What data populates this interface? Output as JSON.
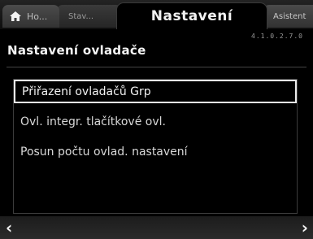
{
  "tabs": {
    "home_label": "Ho...",
    "status_label": "Stav...",
    "active_label": "Nastavení",
    "assist_label": "Asistent"
  },
  "header": {
    "version": "4.1.0.2.7.0"
  },
  "page": {
    "title": "Nastavení ovladače"
  },
  "list": {
    "items": [
      {
        "label": "Přiřazení ovladačů Grp"
      },
      {
        "label": "Ovl. integr. tlačítkové ovl."
      },
      {
        "label": "Posun počtu ovlad. nastavení"
      }
    ]
  },
  "navigation": {
    "prev_arrow": "‹",
    "next_arrow": "›"
  },
  "colors": {
    "background": "#000000",
    "text": "#ffffff",
    "selection_border": "#eaeaea"
  }
}
